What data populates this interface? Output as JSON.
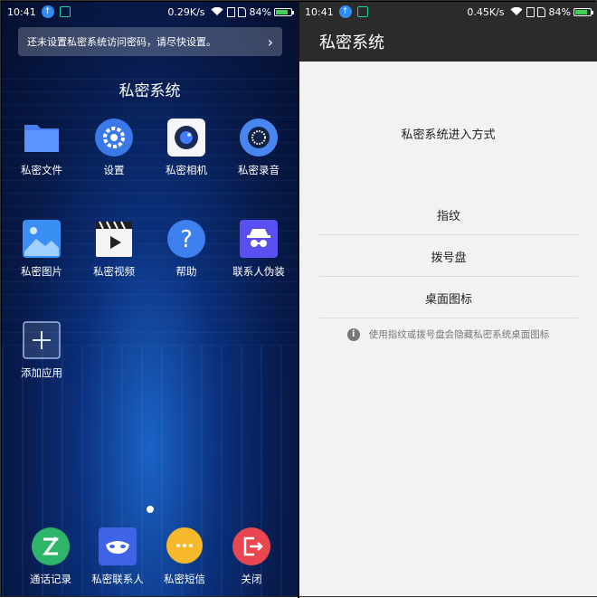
{
  "left": {
    "status": {
      "time": "10:41",
      "speed": "0.29K/s",
      "battery": "84%",
      "battery_level": 0.84
    },
    "notice": {
      "text": "还未设置私密系统访问密码，请尽快设置。"
    },
    "folder_title": "私密系统",
    "apps": [
      {
        "label": "私密文件",
        "icon": "folder-icon"
      },
      {
        "label": "设置",
        "icon": "gear-icon"
      },
      {
        "label": "私密相机",
        "icon": "camera-icon"
      },
      {
        "label": "私密录音",
        "icon": "recorder-icon"
      },
      {
        "label": "私密图片",
        "icon": "image-icon"
      },
      {
        "label": "私密视频",
        "icon": "video-icon"
      },
      {
        "label": "帮助",
        "icon": "help-icon"
      },
      {
        "label": "联系人伪装",
        "icon": "disguise-icon"
      },
      {
        "label": "添加应用",
        "icon": "add-icon"
      }
    ],
    "dock": [
      {
        "label": "通话记录",
        "icon": "call-log-icon"
      },
      {
        "label": "私密联系人",
        "icon": "private-contacts-icon"
      },
      {
        "label": "私密短信",
        "icon": "private-sms-icon"
      },
      {
        "label": "关闭",
        "icon": "exit-icon"
      }
    ]
  },
  "right": {
    "status": {
      "time": "10:41",
      "speed": "0.45K/s",
      "battery": "84%",
      "battery_level": 0.84
    },
    "appbar_title": "私密系统",
    "section_title": "私密系统进入方式",
    "options": [
      {
        "label": "指纹"
      },
      {
        "label": "拨号盘"
      },
      {
        "label": "桌面图标"
      }
    ],
    "hint": "使用指纹或拨号盘会隐藏私密系统桌面图标"
  },
  "colors": {
    "accent": "#2f8df5",
    "appbar": "#2b2b2b",
    "battery": "#43d05a"
  }
}
